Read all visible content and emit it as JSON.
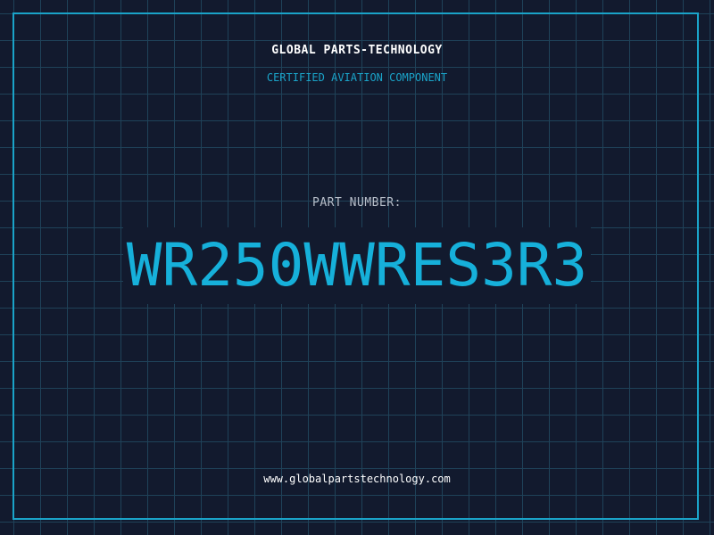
{
  "header": {
    "company": "GLOBAL PARTS-TECHNOLOGY",
    "subtitle": "CERTIFIED AVIATION COMPONENT"
  },
  "part": {
    "label": "PART NUMBER:",
    "number": "WR250WWRES3R3"
  },
  "footer": {
    "website": "www.globalpartstechnology.com"
  },
  "colors": {
    "background": "#121a2e",
    "grid": "#1f4259",
    "accent": "#16b0da",
    "text": "#ffffff"
  }
}
